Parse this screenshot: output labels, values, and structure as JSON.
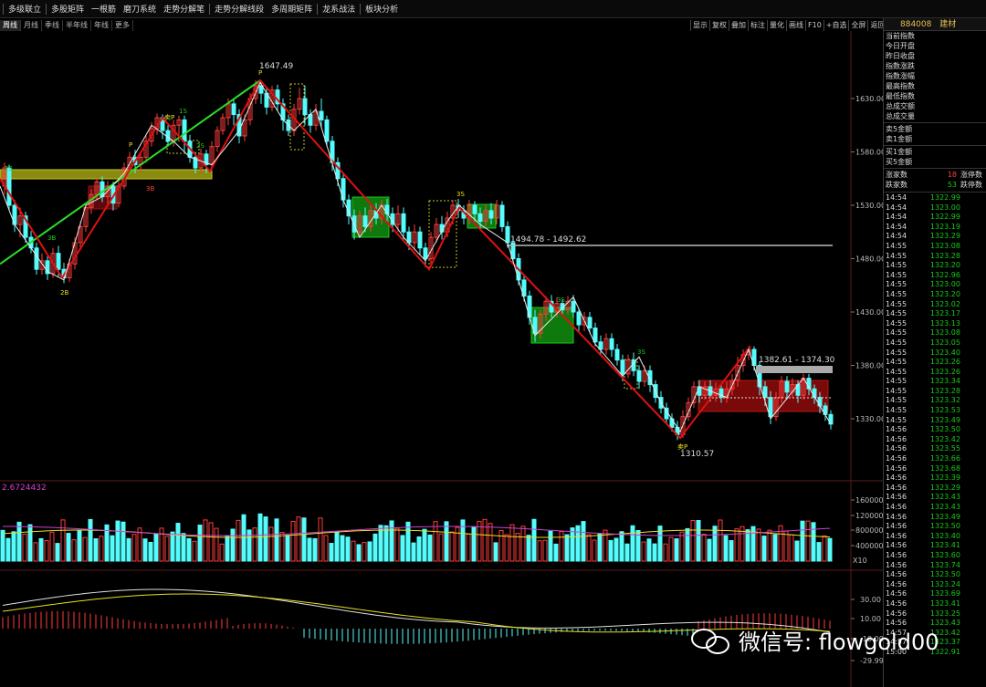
{
  "menu": [
    "多级联立",
    "多股矩阵",
    "一根筋",
    "磨刀系统",
    "走势分解笔",
    "走势分解线段",
    "多周期矩阵",
    "龙系战法",
    "板块分析"
  ],
  "chart_tabs": [
    {
      "label": "周线",
      "active": true
    },
    {
      "label": "月线",
      "active": false
    },
    {
      "label": "季线",
      "active": false
    },
    {
      "label": "半年线",
      "active": false
    },
    {
      "label": "年线",
      "active": false
    },
    {
      "label": "更多",
      "active": false
    }
  ],
  "chart_tools": [
    "显示",
    "复权",
    "叠加",
    "标注",
    "量化",
    "画线",
    "F10",
    "+自选",
    "全屏",
    "返回"
  ],
  "security": {
    "code": "884008",
    "name": "建材"
  },
  "colors": {
    "up": "#ff3c3c",
    "down": "#54fcfc",
    "green": "#19c819",
    "bi_line": "#e01010",
    "trend": "#28e028",
    "yellow": "#e8e020"
  },
  "price_axis": [
    "1630.00",
    "1580.00",
    "1530.00",
    "1480.00",
    "1430.00",
    "1380.00",
    "1330.00"
  ],
  "volume_axis": [
    "1600000",
    "1200000",
    "800000",
    "400000"
  ],
  "volume_scale": "X10",
  "volume_label": "2.6724432",
  "macd_axis": [
    "30.00",
    "10.00",
    "-10.00",
    "-29.99"
  ],
  "annotations": {
    "high": "1647.49",
    "low": "1310.57",
    "level1": "1494.78 - 1492.62",
    "level2": "1382.61 - 1374.30"
  },
  "markers": [
    {
      "text": "P"
    },
    {
      "text": "P"
    },
    {
      "text": "1S"
    },
    {
      "text": "卖P"
    },
    {
      "text": "2S"
    },
    {
      "text": "2S"
    },
    {
      "text": "3B"
    },
    {
      "text": "2B"
    },
    {
      "text": "3B"
    },
    {
      "text": "3S"
    },
    {
      "text": "3S"
    },
    {
      "text": "3S"
    },
    {
      "text": "卖P"
    }
  ],
  "panel": {
    "fields_a": [
      "当前指数",
      "今日开盘",
      "昨日收盘",
      "指数涨跌",
      "指数涨幅",
      "最高指数",
      "最低指数",
      "总成交额",
      "总成交量"
    ],
    "fields_b": [
      "卖5金额",
      "卖1金额"
    ],
    "fields_c": [
      "买1金额",
      "买5金额"
    ],
    "counts": [
      {
        "label": "涨家数",
        "value": "18",
        "label2": "涨停数",
        "color": "#ff3c3c"
      },
      {
        "label": "跌家数",
        "value": "53",
        "label2": "跌停数",
        "color": "#19c819"
      }
    ]
  },
  "ticks": [
    [
      "14:54",
      "1322.99"
    ],
    [
      "14:54",
      "1323.00"
    ],
    [
      "14:54",
      "1322.99"
    ],
    [
      "14:54",
      "1323.19"
    ],
    [
      "14:54",
      "1323.29"
    ],
    [
      "14:55",
      "1323.08"
    ],
    [
      "14:55",
      "1323.28"
    ],
    [
      "14:55",
      "1323.20"
    ],
    [
      "14:55",
      "1322.96"
    ],
    [
      "14:55",
      "1323.00"
    ],
    [
      "14:55",
      "1323.20"
    ],
    [
      "14:55",
      "1323.02"
    ],
    [
      "14:55",
      "1323.17"
    ],
    [
      "14:55",
      "1323.13"
    ],
    [
      "14:55",
      "1323.08"
    ],
    [
      "14:55",
      "1323.05"
    ],
    [
      "14:55",
      "1323.40"
    ],
    [
      "14:55",
      "1323.26"
    ],
    [
      "14:55",
      "1323.26"
    ],
    [
      "14:55",
      "1323.34"
    ],
    [
      "14:55",
      "1323.28"
    ],
    [
      "14:55",
      "1323.32"
    ],
    [
      "14:55",
      "1323.53"
    ],
    [
      "14:55",
      "1323.49"
    ],
    [
      "14:56",
      "1323.50"
    ],
    [
      "14:56",
      "1323.42"
    ],
    [
      "14:56",
      "1323.55"
    ],
    [
      "14:56",
      "1323.66"
    ],
    [
      "14:56",
      "1323.68"
    ],
    [
      "14:56",
      "1323.39"
    ],
    [
      "14:56",
      "1323.29"
    ],
    [
      "14:56",
      "1323.43"
    ],
    [
      "14:56",
      "1323.43"
    ],
    [
      "14:56",
      "1323.49"
    ],
    [
      "14:56",
      "1323.50"
    ],
    [
      "14:56",
      "1323.40"
    ],
    [
      "14:56",
      "1323.41"
    ],
    [
      "14:56",
      "1323.60"
    ],
    [
      "14:56",
      "1323.74"
    ],
    [
      "14:56",
      "1323.50"
    ],
    [
      "14:56",
      "1323.24"
    ],
    [
      "14:56",
      "1323.69"
    ],
    [
      "14:56",
      "1323.41"
    ],
    [
      "14:56",
      "1323.25"
    ],
    [
      "14:56",
      "1323.43"
    ],
    [
      "14:57",
      "1323.42"
    ],
    [
      "14:57",
      "1323.37"
    ],
    [
      "15:00",
      "1322.91"
    ]
  ],
  "watermark": "微信号: flowgold00"
}
